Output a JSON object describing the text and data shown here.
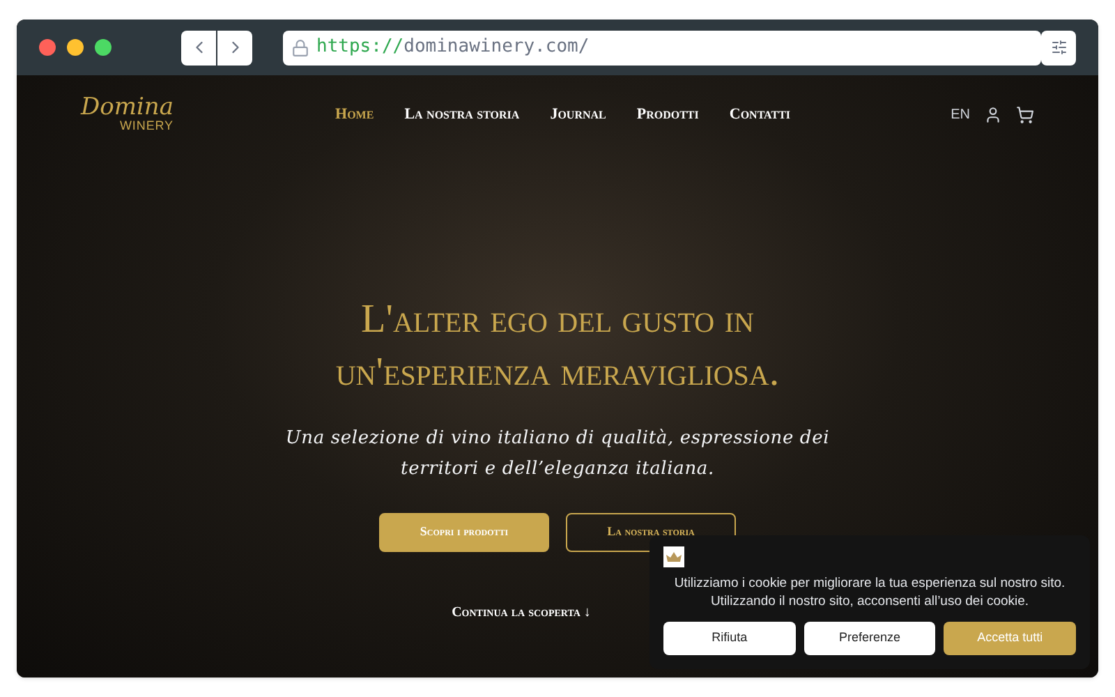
{
  "browser": {
    "url_scheme": "https://",
    "url_host": "dominawinery.com/"
  },
  "header": {
    "logo_script": "Domina",
    "logo_sub": "WINERY",
    "nav": [
      {
        "label": "Home",
        "selected": true
      },
      {
        "label": "La nostra storia",
        "selected": false
      },
      {
        "label": "Journal",
        "selected": false
      },
      {
        "label": "Prodotti",
        "selected": false
      },
      {
        "label": "Contatti",
        "selected": false
      }
    ],
    "language": "EN"
  },
  "hero": {
    "heading_line1": "L'alter ego del gusto in",
    "heading_line2": "un'esperienza meravigliosa.",
    "subtitle": "Una selezione di vino italiano di qualità, espressione dei territori e dell’eleganza italiana.",
    "buttons": [
      {
        "label": "Scopri i prodotti",
        "kind": "filled"
      },
      {
        "label": "La nostra storia",
        "kind": "outline"
      }
    ],
    "scroll_link": "Continua la scoperta",
    "scroll_arrow": "↓"
  },
  "cookie_banner": {
    "message": "Utilizziamo i cookie per migliorare la tua esperienza sul nostro sito. Utilizzando il nostro sito, acconsenti all’uso dei cookie.",
    "buttons": [
      {
        "label": "Rifiuta",
        "kind": "plain"
      },
      {
        "label": "Preferenze",
        "kind": "plain"
      },
      {
        "label": "Accetta tutti",
        "kind": "primary"
      }
    ]
  }
}
